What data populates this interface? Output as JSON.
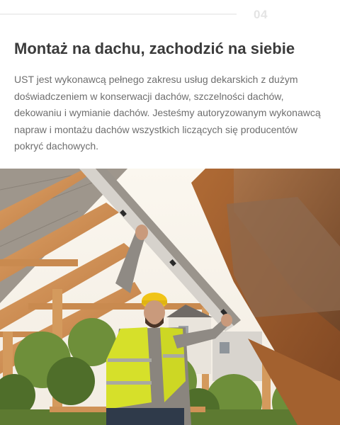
{
  "step": {
    "number": "04"
  },
  "section": {
    "title": "Montaż na dachu, zachodzić na siebie",
    "description": "UST jest wykonawcą pełnego zakresu usług dekarskich z dużym doświadczeniem w konserwacji dachów, szczelności dachów, dekowaniu i wymianie dachów. Jesteśmy autoryzowanym wykonawcą napraw i montażu dachów wszystkich liczących się producentów pokryć dachowych."
  },
  "photo": {
    "subject": "roofer-installing-roof-beams"
  },
  "colors": {
    "title": "#3b3b3b",
    "text": "#6e6e6e",
    "step_number": "#e4e4e4",
    "wood": "#c8874a",
    "vest": "#d6e02a"
  }
}
